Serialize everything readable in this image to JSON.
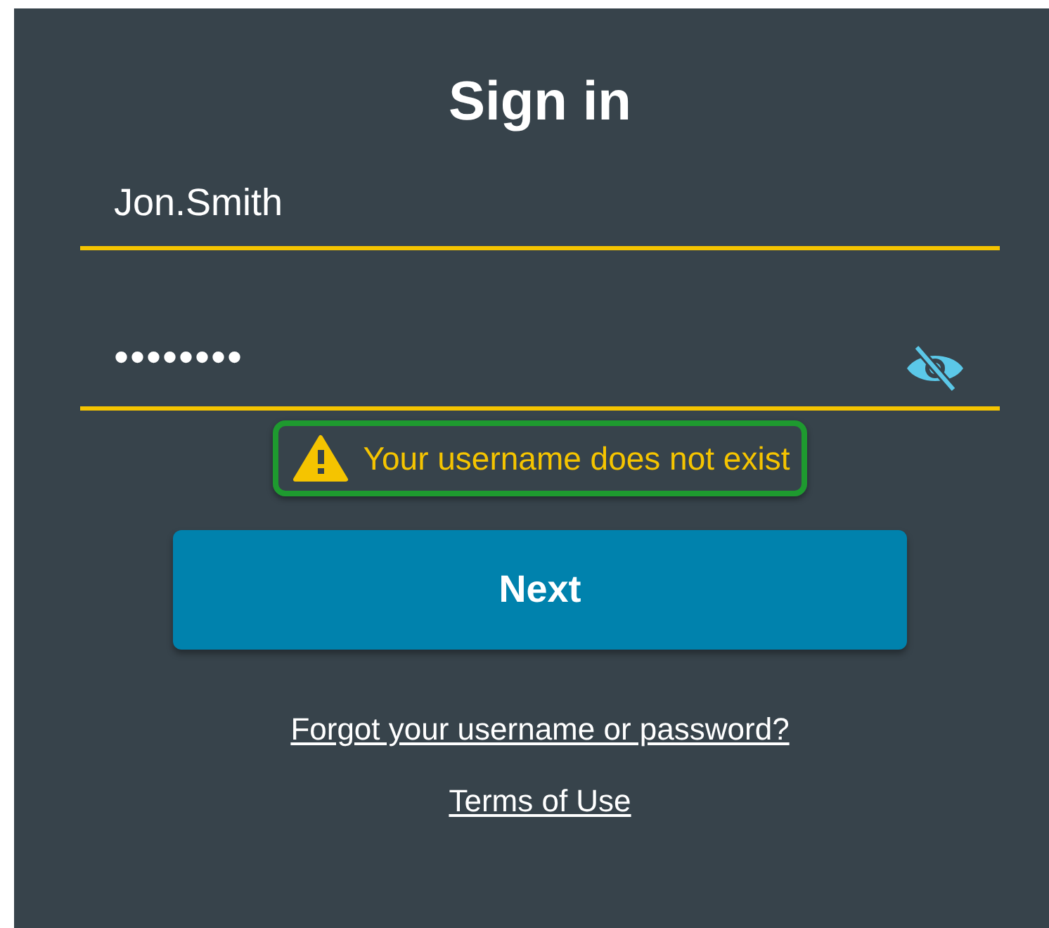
{
  "title": "Sign in",
  "username": {
    "value": "Jon.Smith"
  },
  "password": {
    "value": "••••••••",
    "visible": false
  },
  "error": {
    "text": "Your username does not exist"
  },
  "buttons": [
    "Next"
  ],
  "links": [
    "Forgot your username or password?",
    "Terms of Use"
  ]
}
